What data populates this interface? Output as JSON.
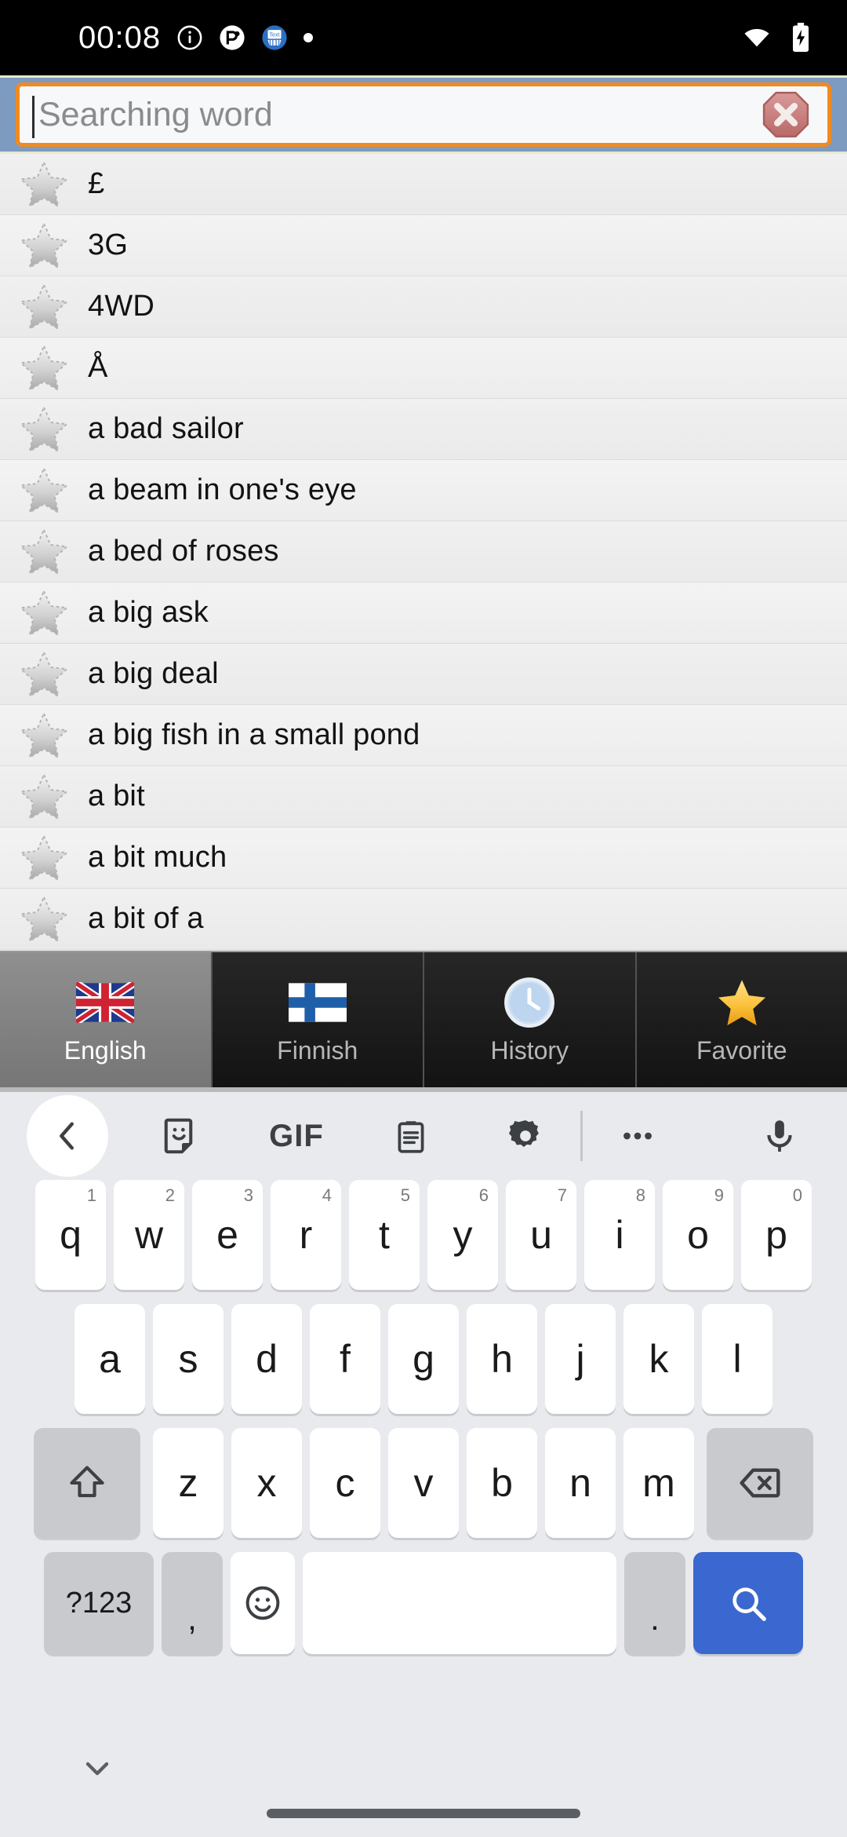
{
  "status_bar": {
    "time": "00:08",
    "icons_left": [
      "info-circle-icon",
      "app-notification-icon",
      "messenger-notification-icon",
      "dot-icon"
    ],
    "icons_right": [
      "wifi-icon",
      "battery-charging-icon"
    ]
  },
  "search": {
    "placeholder": "Searching word",
    "value": "",
    "clear_icon": "clear-octagon-icon",
    "border_color": "#ef8b22",
    "header_bg": "#7d9ac0"
  },
  "word_list": [
    {
      "label": "£",
      "star": "star-outline-icon"
    },
    {
      "label": "3G",
      "star": "star-outline-icon"
    },
    {
      "label": "4WD",
      "star": "star-outline-icon"
    },
    {
      "label": "Å",
      "star": "star-outline-icon"
    },
    {
      "label": "a bad sailor",
      "star": "star-outline-icon"
    },
    {
      "label": "a beam in one's eye",
      "star": "star-outline-icon"
    },
    {
      "label": "a bed of roses",
      "star": "star-outline-icon"
    },
    {
      "label": "a big ask",
      "star": "star-outline-icon"
    },
    {
      "label": "a big deal",
      "star": "star-outline-icon"
    },
    {
      "label": "a big fish in a small pond",
      "star": "star-outline-icon"
    },
    {
      "label": "a bit",
      "star": "star-outline-icon"
    },
    {
      "label": "a bit much",
      "star": "star-outline-icon"
    },
    {
      "label": "a bit of a",
      "star": "star-outline-icon"
    }
  ],
  "tabs": [
    {
      "label": "English",
      "icon": "uk-flag-icon",
      "active": true
    },
    {
      "label": "Finnish",
      "icon": "finland-flag-icon",
      "active": false
    },
    {
      "label": "History",
      "icon": "clock-icon",
      "active": false
    },
    {
      "label": "Favorite",
      "icon": "star-gold-icon",
      "active": false
    }
  ],
  "keyboard": {
    "toolbar": [
      {
        "name": "back-chevron-icon",
        "label": ""
      },
      {
        "name": "sticker-icon",
        "label": ""
      },
      {
        "name": "gif-icon",
        "label": "GIF"
      },
      {
        "name": "clipboard-icon",
        "label": ""
      },
      {
        "name": "gear-icon",
        "label": ""
      },
      {
        "name": "more-horizontal-icon",
        "label": ""
      },
      {
        "name": "microphone-icon",
        "label": ""
      }
    ],
    "row1": [
      {
        "key": "q",
        "hint": "1"
      },
      {
        "key": "w",
        "hint": "2"
      },
      {
        "key": "e",
        "hint": "3"
      },
      {
        "key": "r",
        "hint": "4"
      },
      {
        "key": "t",
        "hint": "5"
      },
      {
        "key": "y",
        "hint": "6"
      },
      {
        "key": "u",
        "hint": "7"
      },
      {
        "key": "i",
        "hint": "8"
      },
      {
        "key": "o",
        "hint": "9"
      },
      {
        "key": "p",
        "hint": "0"
      }
    ],
    "row2": [
      {
        "key": "a"
      },
      {
        "key": "s"
      },
      {
        "key": "d"
      },
      {
        "key": "f"
      },
      {
        "key": "g"
      },
      {
        "key": "h"
      },
      {
        "key": "j"
      },
      {
        "key": "k"
      },
      {
        "key": "l"
      }
    ],
    "row3": [
      {
        "key": "z"
      },
      {
        "key": "x"
      },
      {
        "key": "c"
      },
      {
        "key": "v"
      },
      {
        "key": "b"
      },
      {
        "key": "n"
      },
      {
        "key": "m"
      }
    ],
    "shift_icon": "shift-arrow-icon",
    "backspace_icon": "backspace-icon",
    "row4": {
      "symbols_label": "?123",
      "comma_label": ",",
      "emoji_icon": "emoji-smiley-icon",
      "space_label": "",
      "period_label": ".",
      "enter_icon": "search-magnifier-icon",
      "enter_color": "#3a68d0"
    },
    "nav": {
      "hide_keyboard_icon": "chevron-down-icon",
      "home_indicator": "home-gesture-bar"
    }
  }
}
